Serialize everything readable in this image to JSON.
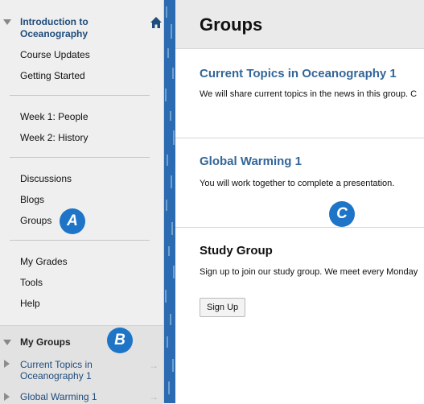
{
  "sidebar": {
    "course_title": "Introduction to Oceanography",
    "items_group1": [
      "Course Updates",
      "Getting Started"
    ],
    "items_group2": [
      "Week 1: People",
      "Week 2: History"
    ],
    "items_group3": [
      "Discussions",
      "Blogs",
      "Groups"
    ],
    "items_group4": [
      "My Grades",
      "Tools",
      "Help"
    ],
    "my_groups": {
      "title": "My Groups",
      "groups": [
        "Current Topics in Oceanography 1",
        "Global Warming 1"
      ]
    }
  },
  "callouts": [
    "A",
    "B",
    "C"
  ],
  "main": {
    "page_title": "Groups",
    "groups": [
      {
        "name": "Current Topics in Oceanography 1",
        "description": "We will share current topics in the news in this group. C"
      },
      {
        "name": "Global Warming 1",
        "description": "You will work together to complete a presentation."
      },
      {
        "name": "Study Group",
        "description": "Sign up to join our study group. We meet every Monday"
      }
    ],
    "signup_label": "Sign Up"
  },
  "colors": {
    "link": "#1f4c7c",
    "accent": "#1e74c6",
    "strip": "#2b6bb1"
  }
}
